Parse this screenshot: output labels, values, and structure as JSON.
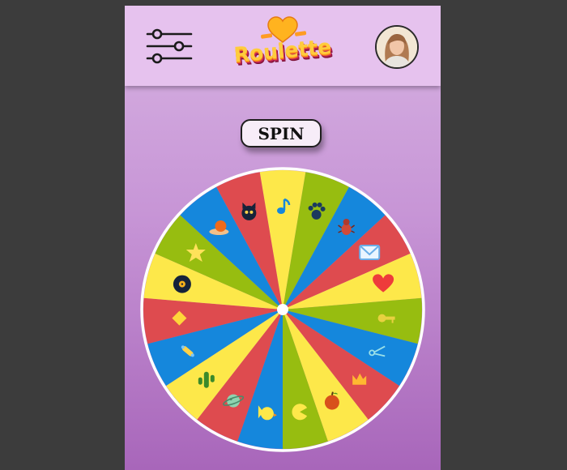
{
  "header": {
    "logo_text": "Roulette",
    "menu_icon": "sliders-icon",
    "avatar_icon": "user-avatar"
  },
  "spin": {
    "label": "SPIN"
  },
  "wheel": {
    "segment_colors": [
      "#fde84a",
      "#97bd10",
      "#1587dc",
      "#de4b4f"
    ],
    "rim_color": "#ffffff",
    "segments": [
      {
        "color": "#fde84a",
        "icon": "music-note-icon"
      },
      {
        "color": "#97bd10",
        "icon": "paw-icon"
      },
      {
        "color": "#1587dc",
        "icon": "bug-icon"
      },
      {
        "color": "#de4b4f",
        "icon": "envelope-icon"
      },
      {
        "color": "#fde84a",
        "icon": "heart-icon"
      },
      {
        "color": "#97bd10",
        "icon": "key-icon"
      },
      {
        "color": "#1587dc",
        "icon": "scissors-icon"
      },
      {
        "color": "#de4b4f",
        "icon": "crown-icon"
      },
      {
        "color": "#fde84a",
        "icon": "apple-icon"
      },
      {
        "color": "#97bd10",
        "icon": "pacman-icon"
      },
      {
        "color": "#1587dc",
        "icon": "chick-icon"
      },
      {
        "color": "#de4b4f",
        "icon": "planet-icon"
      },
      {
        "color": "#fde84a",
        "icon": "cactus-icon"
      },
      {
        "color": "#1587dc",
        "icon": "candy-icon"
      },
      {
        "color": "#de4b4f",
        "icon": "diamond-icon"
      },
      {
        "color": "#fde84a",
        "icon": "vinyl-record-icon"
      },
      {
        "color": "#97bd10",
        "icon": "star-icon"
      },
      {
        "color": "#1587dc",
        "icon": "snail-icon"
      },
      {
        "color": "#de4b4f",
        "icon": "cat-icon"
      }
    ]
  }
}
